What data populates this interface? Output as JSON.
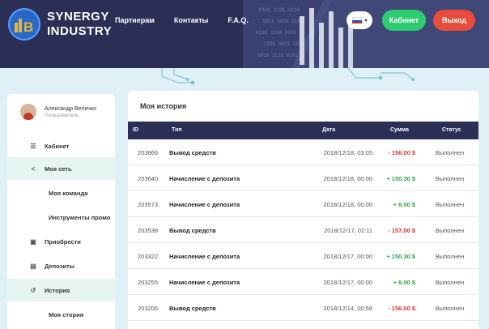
{
  "brand": {
    "line1": "SYNERGY",
    "line2": "INDUSTRY"
  },
  "nav": [
    "Партнерам",
    "Контакты",
    "F.A.Q."
  ],
  "header": {
    "cabinet_label": "Кабинет",
    "exit_label": "Выход"
  },
  "user": {
    "name": "Александр Величко",
    "role": "Пользователь"
  },
  "sidebar": {
    "items": [
      {
        "label": "Кабинет",
        "icon": "list-icon"
      },
      {
        "label": "Моя сеть",
        "icon": "share-icon"
      },
      {
        "label": "Моя команда"
      },
      {
        "label": "Инструменты промо"
      },
      {
        "label": "Приобрести",
        "icon": "cart-icon"
      },
      {
        "label": "Депозиты",
        "icon": "box-icon"
      },
      {
        "label": "История",
        "icon": "history-icon"
      },
      {
        "label": "Моя стория"
      }
    ]
  },
  "history": {
    "title": "Моя история",
    "columns": [
      "ID",
      "Тип",
      "Дата",
      "Сумма",
      "Статус"
    ],
    "rows": [
      {
        "id": "203866",
        "type": "Вывод средств",
        "date": "2018/12/18, 03:05",
        "sum": "- 156.00 $",
        "status": "Выполнен"
      },
      {
        "id": "203640",
        "type": "Начисление с депозита",
        "date": "2018/12/18, 00:00",
        "sum": "+ 150.30 $",
        "status": "Выполнен"
      },
      {
        "id": "203573",
        "type": "Начисление с депозита",
        "date": "2018/12/18, 00:00",
        "sum": "+ 6.00 $",
        "status": "Выполнен"
      },
      {
        "id": "203538",
        "type": "Вывод средств",
        "date": "2018/12/17, 02:11",
        "sum": "- 157.00 $",
        "status": "Выполнен"
      },
      {
        "id": "203322",
        "type": "Начисление с депозита",
        "date": "2018/12/17, 00:00",
        "sum": "+ 150.30 $",
        "status": "Выполнен"
      },
      {
        "id": "203255",
        "type": "Начисление с депозита",
        "date": "2018/12/17, 00:00",
        "sum": "+ 6.00 $",
        "status": "Выполнен"
      },
      {
        "id": "203206",
        "type": "Вывод средств",
        "date": "2018/12/14, 00:58",
        "sum": "- 156.00 $",
        "status": "Выполнен"
      }
    ]
  },
  "colors": {
    "header_bg": "#2b2f55",
    "accent_green": "#2ecc71",
    "accent_red": "#e74c3c",
    "page_bg": "#dff1f6"
  }
}
